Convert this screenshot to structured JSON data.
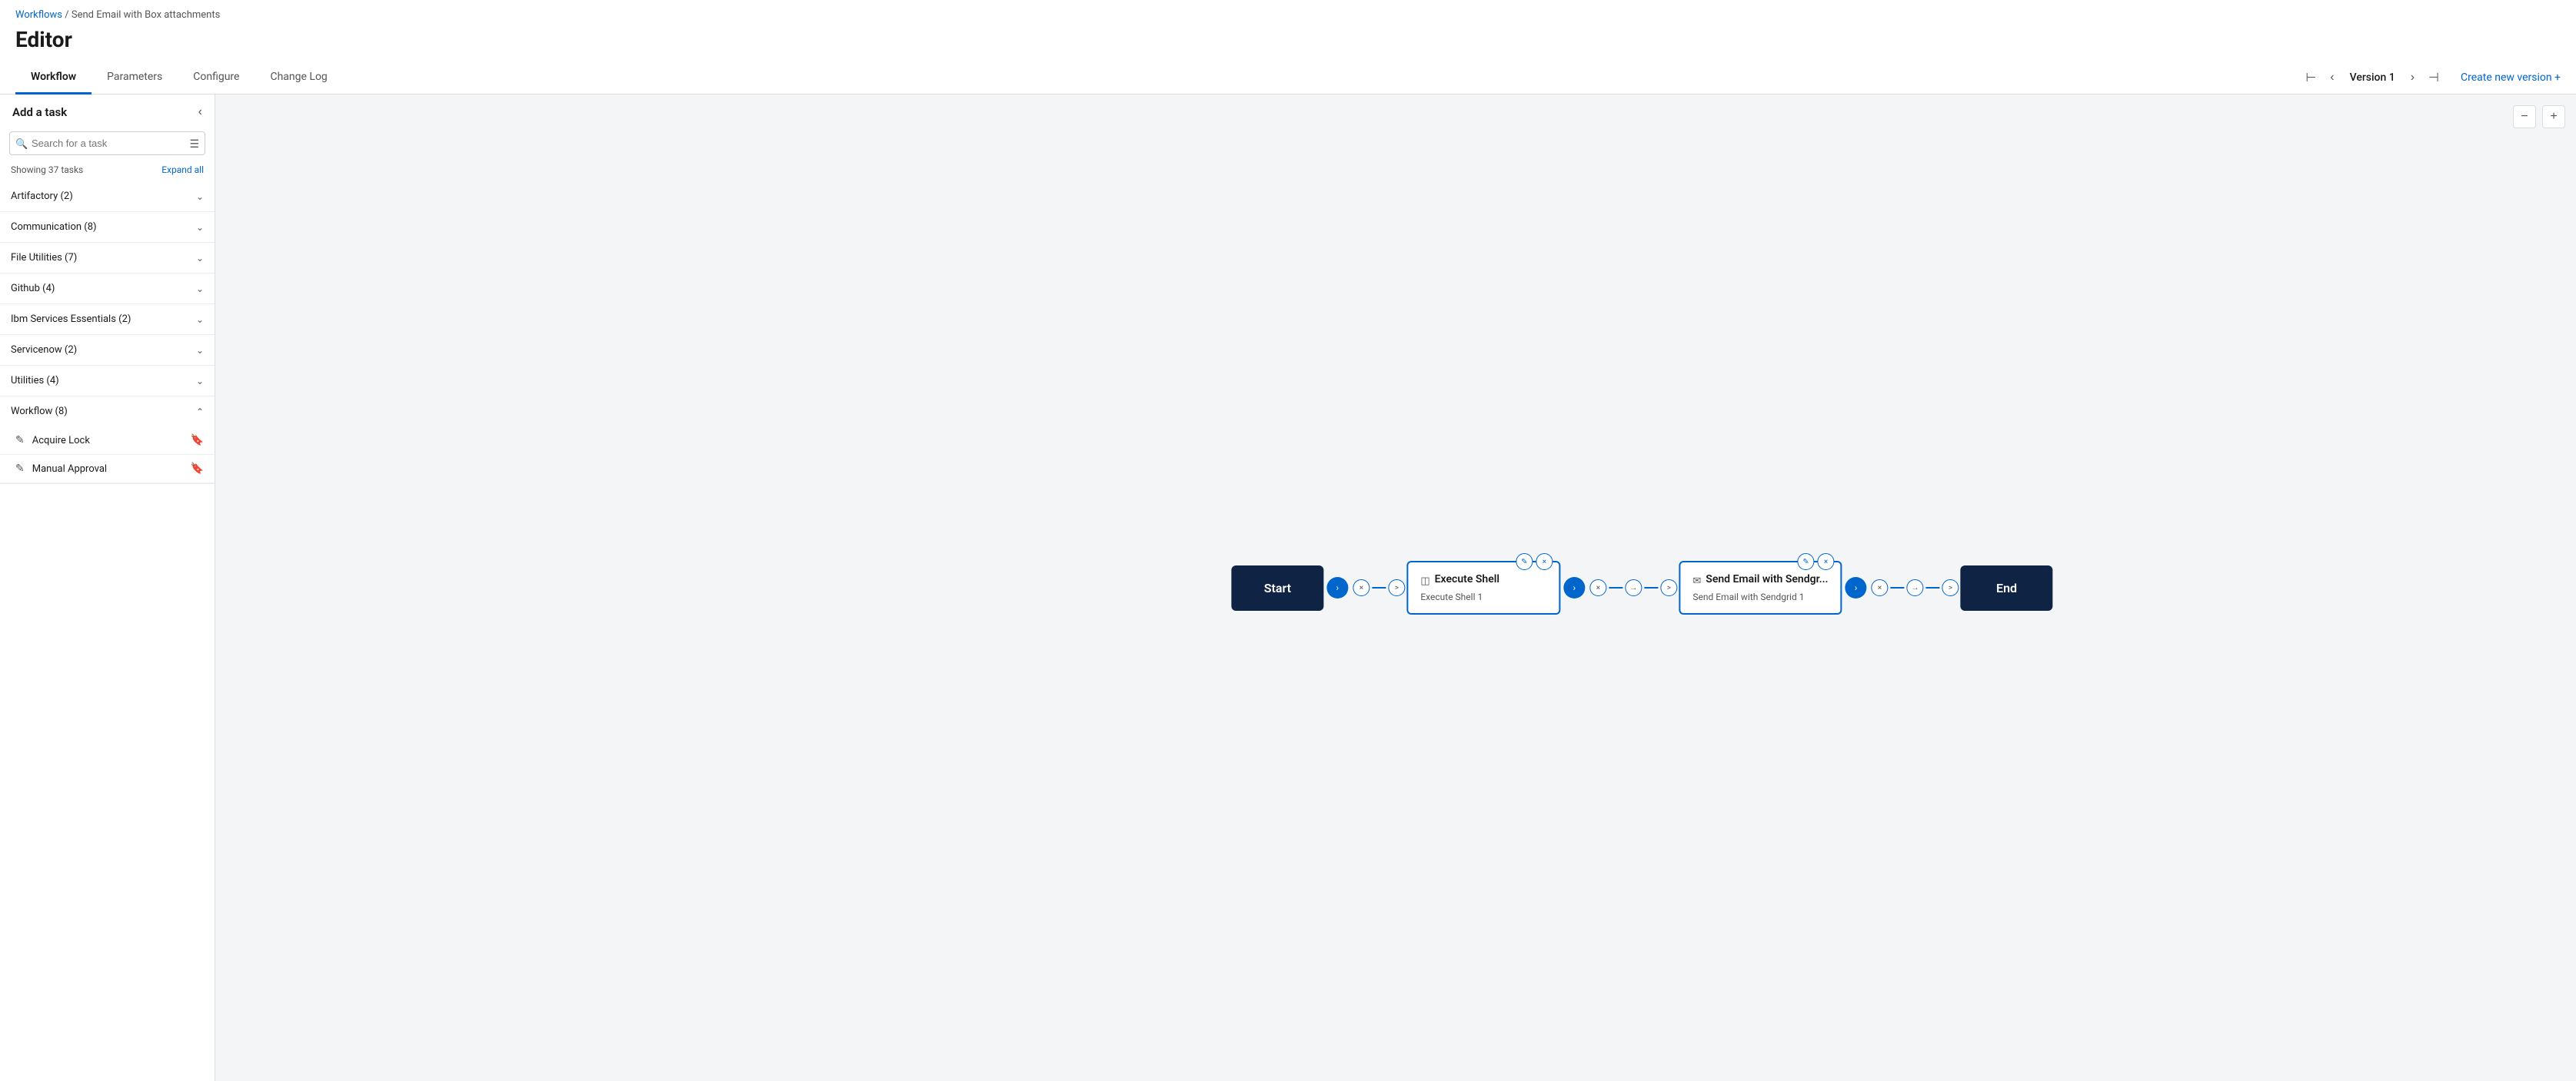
{
  "breadcrumb": {
    "workflows_label": "Workflows",
    "separator": "/",
    "current_page": "Send Email with Box attachments"
  },
  "page_title": "Editor",
  "tabs": [
    {
      "id": "workflow",
      "label": "Workflow",
      "active": true
    },
    {
      "id": "parameters",
      "label": "Parameters",
      "active": false
    },
    {
      "id": "configure",
      "label": "Configure",
      "active": false
    },
    {
      "id": "change_log",
      "label": "Change Log",
      "active": false
    }
  ],
  "version": {
    "label": "Version 1",
    "create_new_label": "Create new version +"
  },
  "sidebar": {
    "title": "Add a task",
    "collapse_icon": "‹",
    "search_placeholder": "Search for a task",
    "task_count_label": "Showing 37 tasks",
    "expand_all_label": "Expand all",
    "categories": [
      {
        "id": "artifactory",
        "label": "Artifactory (2)",
        "expanded": false
      },
      {
        "id": "communication",
        "label": "Communication (8)",
        "expanded": false
      },
      {
        "id": "file_utilities",
        "label": "File Utilities (7)",
        "expanded": false
      },
      {
        "id": "github",
        "label": "Github (4)",
        "expanded": false
      },
      {
        "id": "ibm_services",
        "label": "Ibm Services Essentials (2)",
        "expanded": false
      },
      {
        "id": "servicenow",
        "label": "Servicenow (2)",
        "expanded": false
      },
      {
        "id": "utilities",
        "label": "Utilities (4)",
        "expanded": false
      },
      {
        "id": "workflow",
        "label": "Workflow (8)",
        "expanded": true
      }
    ],
    "workflow_tasks": [
      {
        "label": "Acquire Lock"
      },
      {
        "label": "Manual Approval"
      }
    ]
  },
  "workflow": {
    "nodes": [
      {
        "id": "start",
        "type": "terminal",
        "label": "Start"
      },
      {
        "id": "execute_shell",
        "type": "task",
        "title": "Execute Shell",
        "subtitle": "Execute Shell 1",
        "icon": "terminal"
      },
      {
        "id": "send_email",
        "type": "task",
        "title": "Send Email with Sendgr...",
        "subtitle": "Send Email with Sendgrid 1",
        "icon": "email"
      },
      {
        "id": "end",
        "type": "terminal",
        "label": "End"
      }
    ]
  },
  "zoom": {
    "zoom_out_label": "−",
    "zoom_in_label": "+"
  }
}
